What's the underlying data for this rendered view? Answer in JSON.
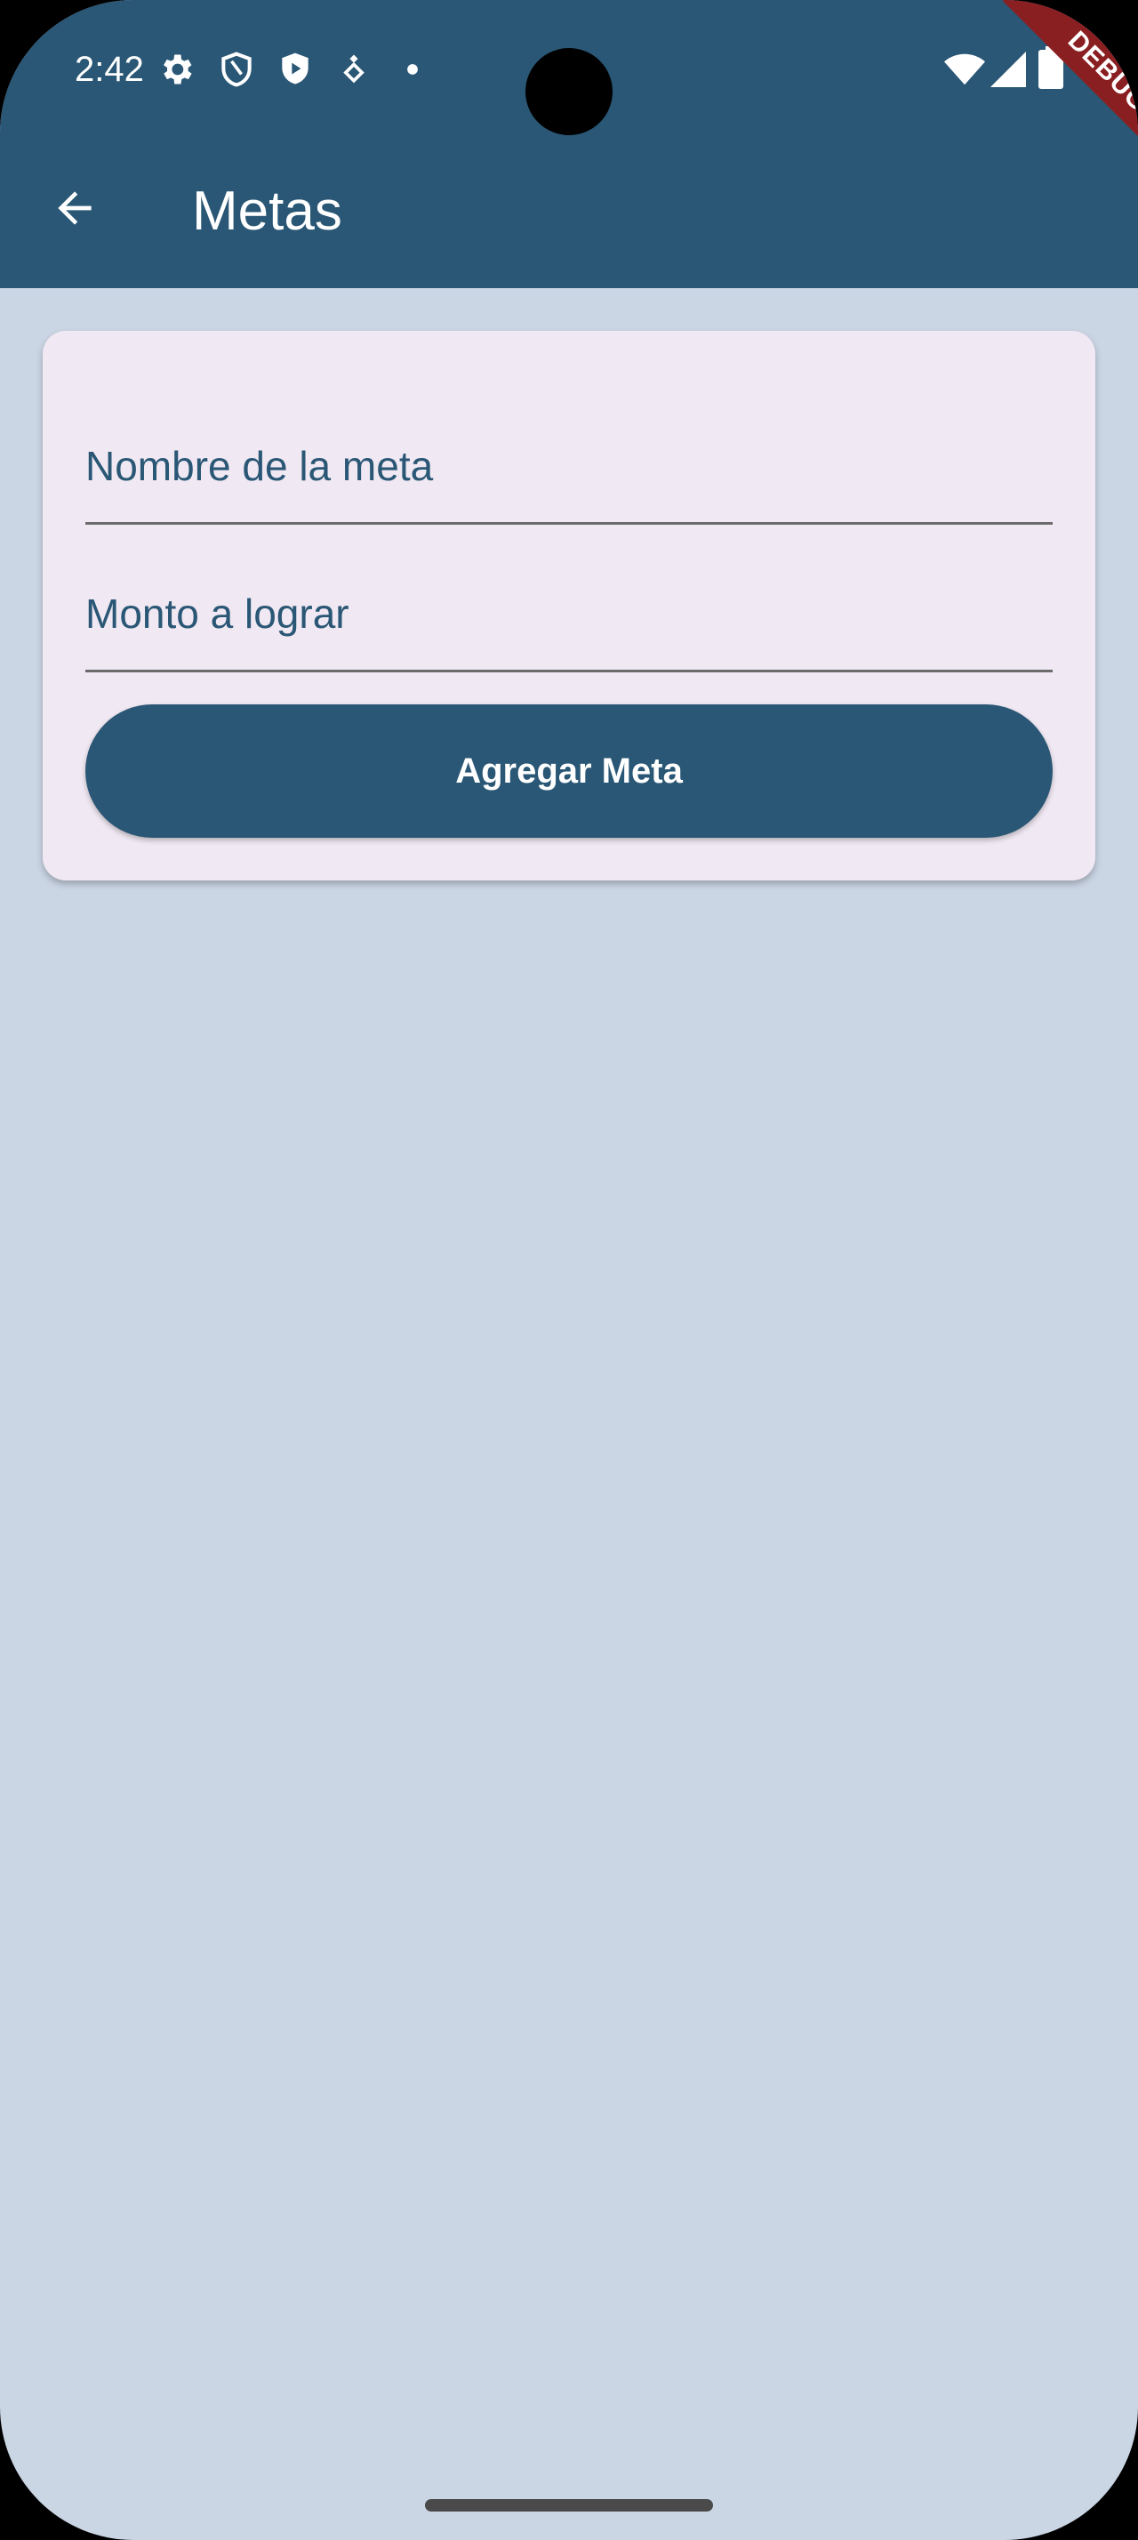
{
  "status_bar": {
    "time": "2:42",
    "icons": [
      "settings-icon",
      "shield-icon",
      "play-shield-icon",
      "diamond-icon",
      "dot-icon",
      "wifi-icon",
      "signal-icon",
      "battery-icon"
    ]
  },
  "debug_banner": {
    "label": "DEBUG"
  },
  "app_bar": {
    "title": "Metas",
    "back_icon": "arrow-back-icon"
  },
  "form": {
    "goal_name_placeholder": "Nombre de la meta",
    "goal_name_value": "",
    "amount_placeholder": "Monto a lograr",
    "amount_value": "",
    "submit_label": "Agregar Meta"
  },
  "colors": {
    "primary": "#2a5775",
    "background": "#cbd6e5",
    "card": "#f0e8f2",
    "debug": "#8a1f22"
  }
}
